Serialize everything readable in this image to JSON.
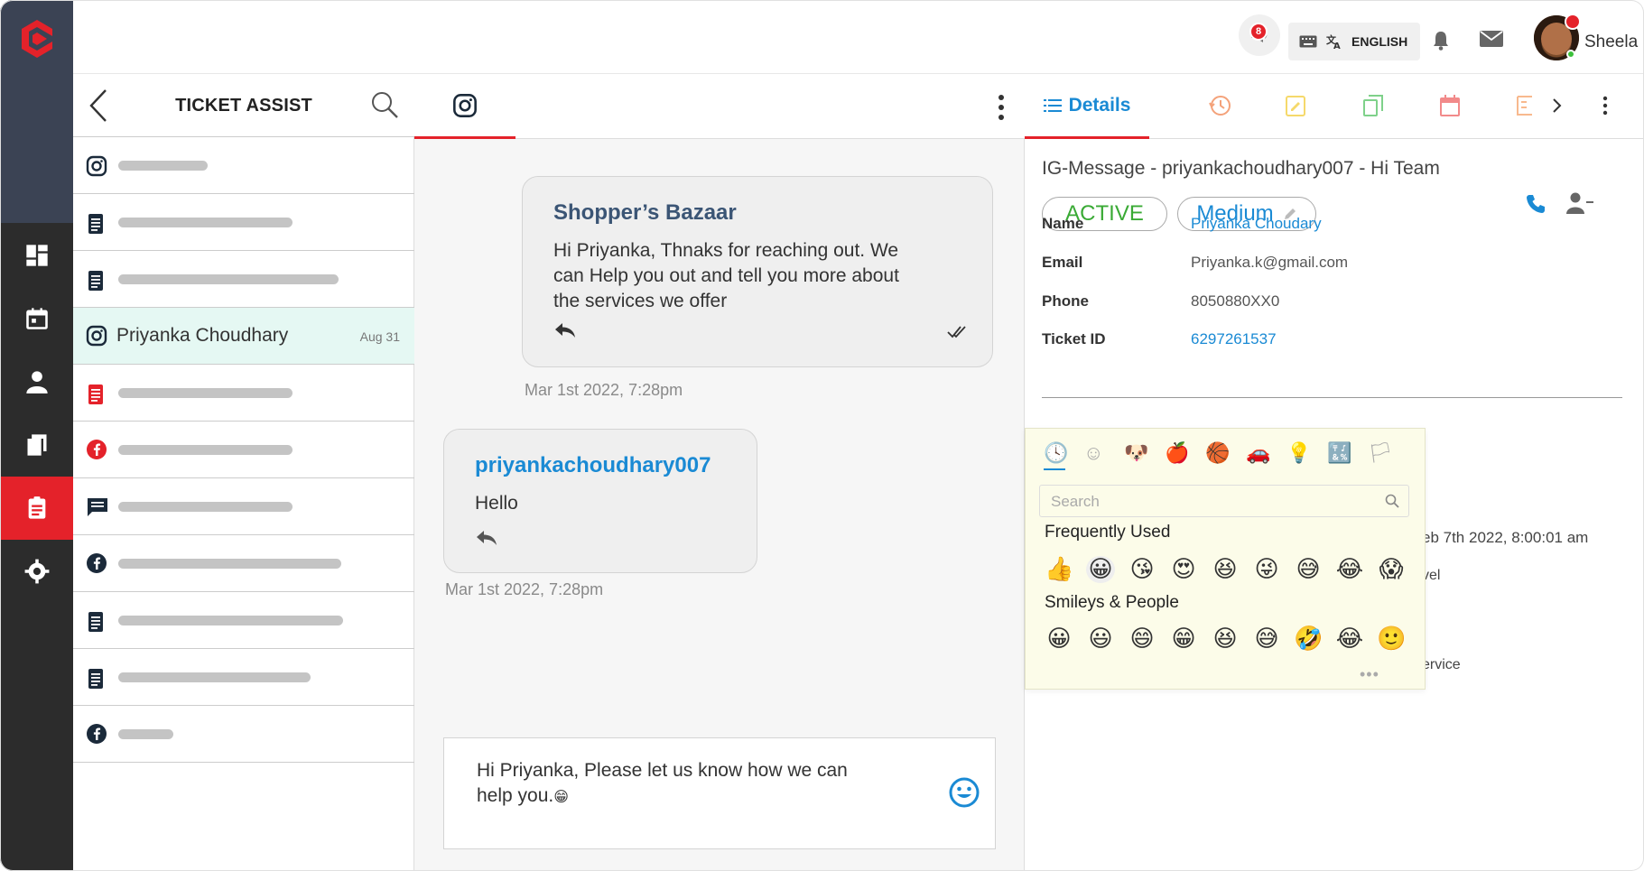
{
  "header": {
    "announcement_badge": "8",
    "language_label": "ENGLISH",
    "username": "Sheela"
  },
  "ticket_list": {
    "title": "TICKET ASSIST",
    "selected": {
      "name": "Priyanka Choudhary",
      "date": "Aug 31"
    }
  },
  "chat": {
    "messages": [
      {
        "sender": "Shopper’s Bazaar",
        "text_lines": [
          "Hi Priyanka, Thnaks  for reaching out. We",
          "can Help you out and tell you more about",
          "the services we offer"
        ],
        "timestamp": "Mar 1st 2022, 7:28pm",
        "sender_color": "#3b5575"
      },
      {
        "sender": "priyankachoudhary007",
        "text_lines": [
          "Hello"
        ],
        "timestamp": "Mar 1st 2022, 7:28pm",
        "sender_color": "#1a8ad4"
      }
    ],
    "composer_text_line1": "Hi Priyanka, Please let us know how we can",
    "composer_text_line2": "help you.",
    "composer_emoji": "😁"
  },
  "details": {
    "tab_label": "Details",
    "title": "IG-Message - priyankachoudhary007 - Hi Team",
    "status": "ACTIVE",
    "priority": "Medium",
    "fields": [
      {
        "label": "Name",
        "value": "Priyanka Choudary",
        "link": true
      },
      {
        "label": "Email",
        "value": "Priyanka.k@gmail.com",
        "link": false
      },
      {
        "label": "Phone",
        "value": "8050880XX0",
        "link": false
      },
      {
        "label": "Ticket ID",
        "value": "6297261537",
        "link": true
      }
    ],
    "partial_date": "eb 7th 2022, 8:00:01 am",
    "partial_1": "vel",
    "partial_2": "ervice"
  },
  "emoji_picker": {
    "search_placeholder": "Search",
    "frequently_used_label": "Frequently Used",
    "frequently_used": [
      "👍",
      "😀",
      "😘",
      "😍",
      "😆",
      "😜",
      "😅",
      "😂",
      "😱"
    ],
    "smileys_label": "Smileys & People",
    "smileys": [
      "😀",
      "😃",
      "😄",
      "😁",
      "😆",
      "😅",
      "🤣",
      "😂",
      "🙂"
    ],
    "categories": [
      "🕓",
      "☺",
      "🐶",
      "🍎",
      "🏀",
      "🚗",
      "💡",
      "🔣",
      "🏳"
    ],
    "more": "•••"
  },
  "colors": {
    "accent_red": "#e4222a",
    "link_blue": "#1a8ad4",
    "status_green": "#3aaa35"
  }
}
